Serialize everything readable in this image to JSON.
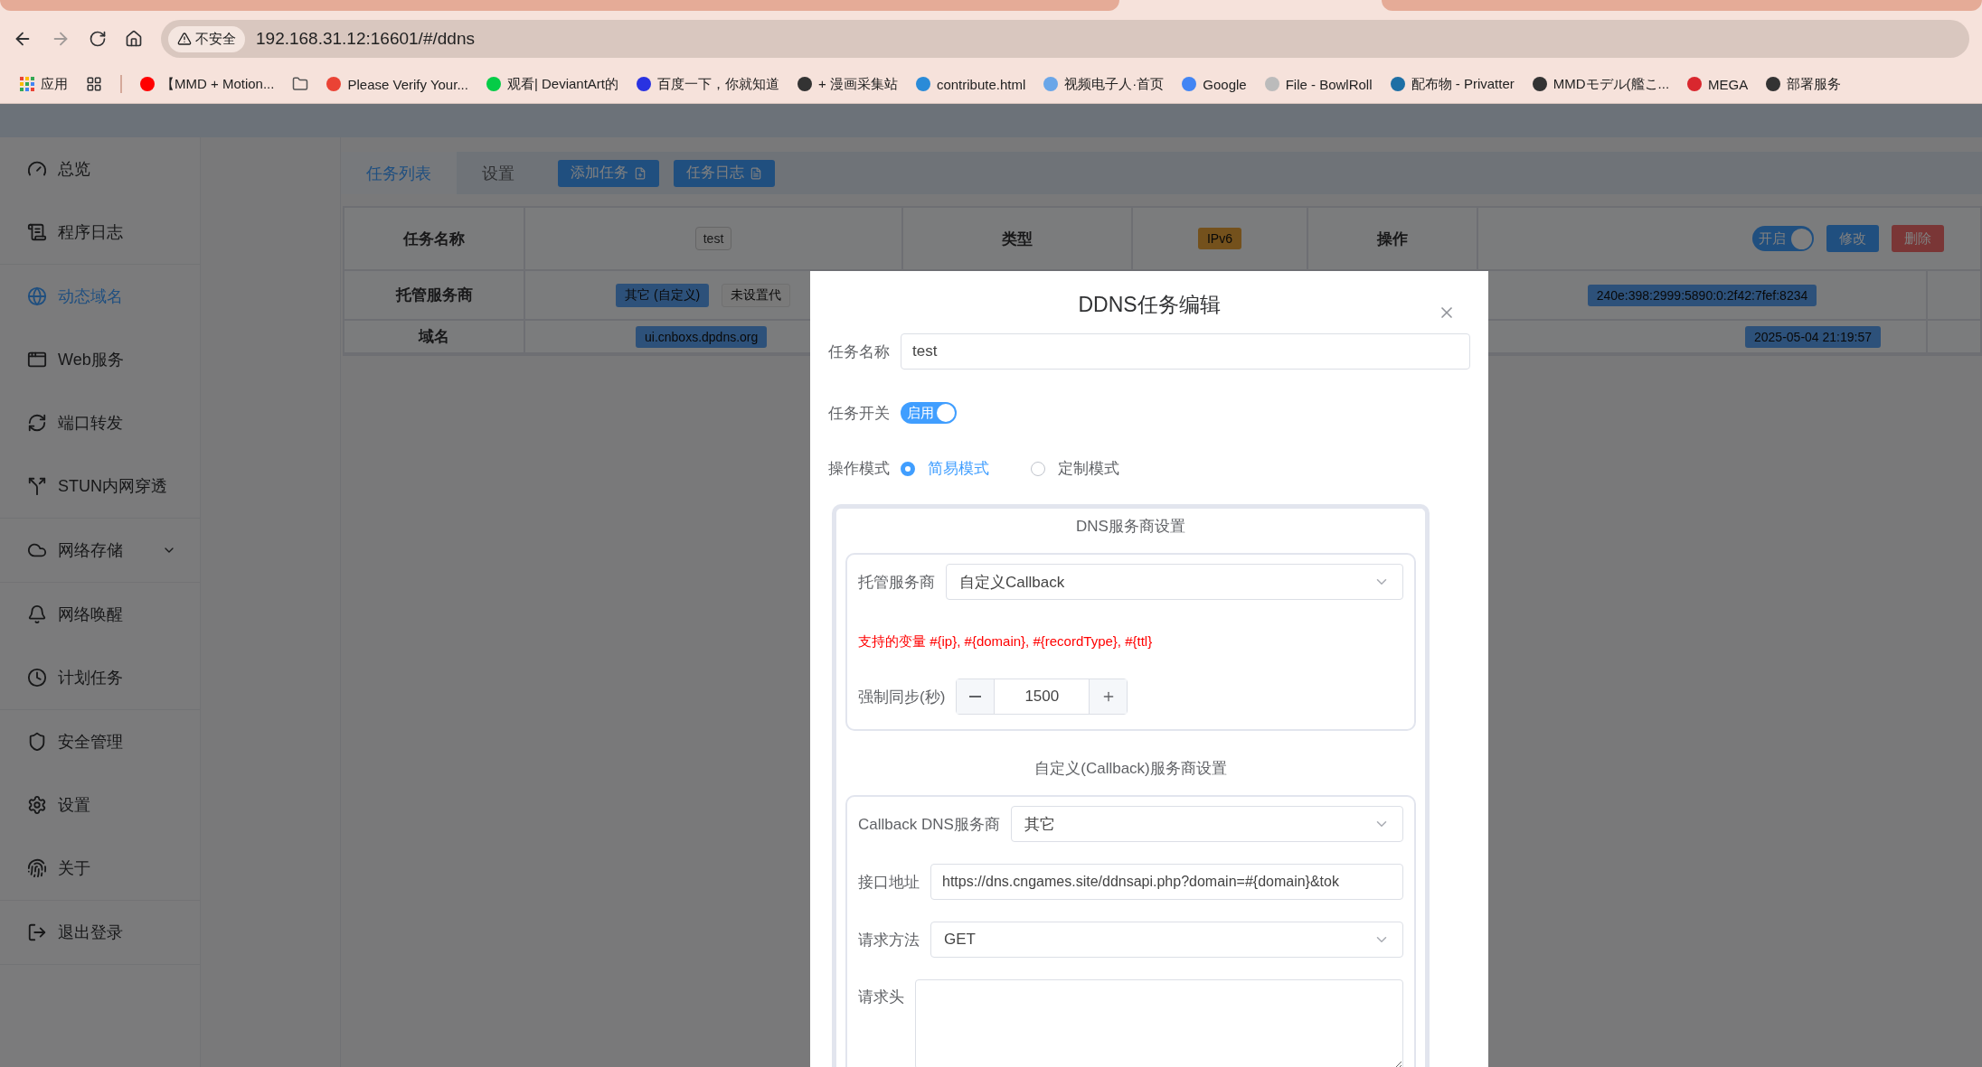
{
  "browser": {
    "security": "不安全",
    "url": "192.168.31.12:16601/#/ddns",
    "bookmarks": [
      {
        "kind": "apps",
        "label": "应用"
      },
      {
        "kind": "grid"
      },
      {
        "kind": "divider"
      },
      {
        "kind": "link",
        "label": "【MMD + Motion...",
        "color": "#ff0000"
      },
      {
        "kind": "folder"
      },
      {
        "kind": "link",
        "label": "Please Verify Your...",
        "color": "#ea4335"
      },
      {
        "kind": "link",
        "label": "观看| DeviantArt的",
        "color": "#05cc47"
      },
      {
        "kind": "link",
        "label": "百度一下，你就知道",
        "color": "#2932e1"
      },
      {
        "kind": "link",
        "label": "+ 漫画采集站",
        "color": "#333333"
      },
      {
        "kind": "link",
        "label": "contribute.html",
        "color": "#2a8bd8"
      },
      {
        "kind": "link",
        "label": "视频电子人·首页",
        "color": "#6aa6e8"
      },
      {
        "kind": "link",
        "label": "Google",
        "color": "#4285f4"
      },
      {
        "kind": "link",
        "label": "File - BowlRoll",
        "color": "#bbbbbb"
      },
      {
        "kind": "link",
        "label": "配布物 - Privatter",
        "color": "#1d6fa5"
      },
      {
        "kind": "link",
        "label": "MMDモデル(艦こ...",
        "color": "#333333"
      },
      {
        "kind": "link",
        "label": "MEGA",
        "color": "#d9272e"
      },
      {
        "kind": "link",
        "label": "部署服务",
        "color": "#333333"
      }
    ]
  },
  "sidebar": {
    "groups": [
      [
        {
          "label": "总览",
          "selected": false,
          "submenu": false
        },
        {
          "label": "程序日志",
          "selected": false,
          "submenu": false
        }
      ],
      [
        {
          "label": "动态域名",
          "selected": true,
          "submenu": false
        },
        {
          "label": "Web服务",
          "selected": false,
          "submenu": false
        },
        {
          "label": "端口转发",
          "selected": false,
          "submenu": false
        },
        {
          "label": "STUN内网穿透",
          "selected": false,
          "submenu": false
        }
      ],
      [
        {
          "label": "网络存储",
          "selected": false,
          "submenu": true
        }
      ],
      [
        {
          "label": "网络唤醒",
          "selected": false,
          "submenu": false
        },
        {
          "label": "计划任务",
          "selected": false,
          "submenu": false
        }
      ],
      [
        {
          "label": "安全管理",
          "selected": false,
          "submenu": false
        },
        {
          "label": "设置",
          "selected": false,
          "submenu": false
        },
        {
          "label": "关于",
          "selected": false,
          "submenu": false
        }
      ],
      [
        {
          "label": "退出登录",
          "selected": false,
          "submenu": false
        }
      ]
    ]
  },
  "tabs": [
    {
      "label": "任务列表",
      "selected": true
    },
    {
      "label": "设置",
      "selected": false
    }
  ],
  "tab_buttons": [
    "添加任务",
    "任务日志"
  ],
  "task": {
    "name_label": "任务名称",
    "name": "test",
    "type_label": "类型",
    "type": "IPv6",
    "action_label": "操作",
    "switch": {
      "label": "开启",
      "on": true
    },
    "actions": [
      {
        "label": "修改",
        "kind": "primary"
      },
      {
        "label": "删除",
        "kind": "danger"
      }
    ],
    "provider_label": "托管服务商",
    "provider_tags": [
      {
        "text": "其它 (自定义)",
        "kind": "primary"
      },
      {
        "text": "未设置代",
        "kind": "plain"
      }
    ],
    "ip": "240e:398:2999:5890:0:2f42:7fef:8234",
    "domain_label": "域名",
    "domain": "ui.cnboxs.dpdns.org",
    "updated": "2025-05-04 21:19:57"
  },
  "modal": {
    "title": "DDNS任务编辑",
    "fields": [
      {
        "kind": "text",
        "label": "任务名称",
        "value": "test"
      },
      {
        "kind": "switch",
        "label": "任务开关",
        "text": "启用",
        "on": true
      },
      {
        "kind": "radio",
        "label": "操作模式",
        "options": [
          {
            "label": "简易模式",
            "selected": true
          },
          {
            "label": "定制模式",
            "selected": false
          }
        ]
      }
    ],
    "sections": [
      {
        "title": "DNS服务商设置",
        "fields": [
          {
            "kind": "select",
            "label": "托管服务商",
            "value": "自定义Callback"
          },
          {
            "kind": "note",
            "text": "支持的变量 #{ip}, #{domain}, #{recordType}, #{ttl}"
          },
          {
            "kind": "number",
            "label": "强制同步(秒)",
            "value": "1500"
          }
        ]
      },
      {
        "title": "自定义(Callback)服务商设置",
        "fields": [
          {
            "kind": "select",
            "label": "Callback DNS服务商",
            "value": "其它"
          },
          {
            "kind": "text",
            "label": "接口地址",
            "value": "https://dns.cngames.site/ddnsapi.php?domain=#{domain}&tok"
          },
          {
            "kind": "select",
            "label": "请求方法",
            "value": "GET"
          },
          {
            "kind": "textarea",
            "label": "请求头"
          }
        ]
      }
    ]
  }
}
